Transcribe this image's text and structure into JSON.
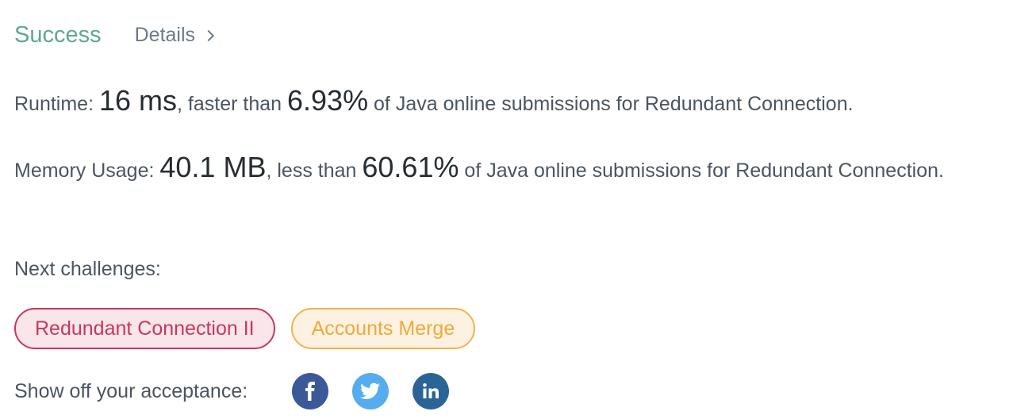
{
  "header": {
    "status": "Success",
    "details_label": "Details"
  },
  "runtime": {
    "label": "Runtime: ",
    "value": "16 ms",
    "middle": ", faster than ",
    "percent": "6.93%",
    "suffix": " of Java online submissions for Redundant Connection."
  },
  "memory": {
    "label": "Memory Usage: ",
    "value": "40.1 MB",
    "middle": ", less than ",
    "percent": "60.61%",
    "suffix": " of Java online submissions for Redundant Connection."
  },
  "next_challenges": {
    "label": "Next challenges:",
    "items": [
      {
        "label": "Redundant Connection II",
        "difficulty": "hard",
        "color": "#c9375e"
      },
      {
        "label": "Accounts Merge",
        "difficulty": "medium",
        "color": "#f0a93a"
      }
    ]
  },
  "share": {
    "label": "Show off your acceptance:",
    "icons": [
      {
        "name": "facebook-icon",
        "color": "#3b5998"
      },
      {
        "name": "twitter-icon",
        "color": "#55acee"
      },
      {
        "name": "linkedin-icon",
        "color": "#2a6496"
      }
    ]
  }
}
